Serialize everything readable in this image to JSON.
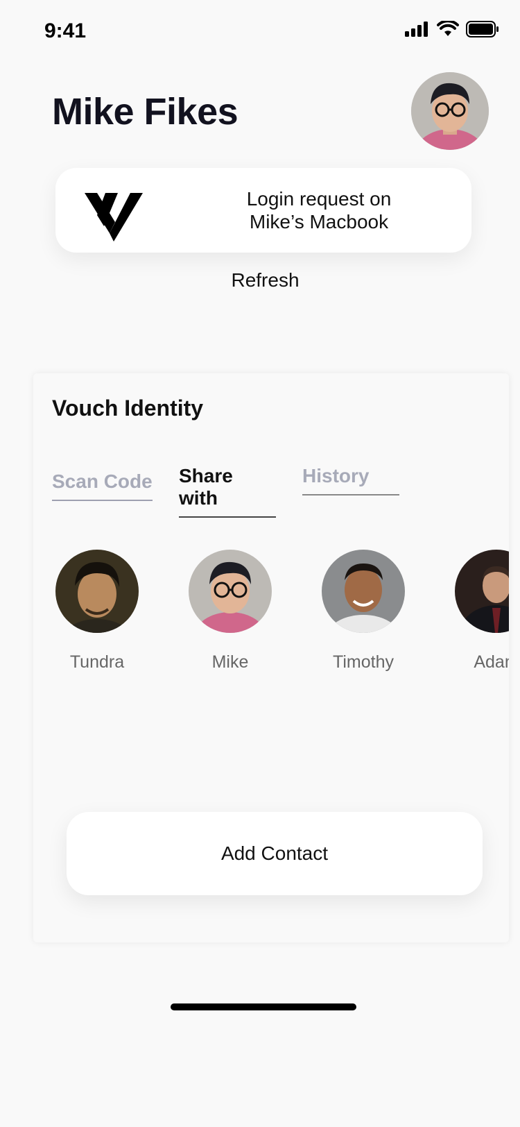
{
  "status_bar": {
    "time": "9:41",
    "icons": [
      "signal-icon",
      "wifi-icon",
      "battery-icon"
    ]
  },
  "header": {
    "title": "Mike Fikes"
  },
  "login_request": {
    "line1": "Login request on",
    "line2": "Mike’s Macbook"
  },
  "refresh_label": "Refresh",
  "identity": {
    "title": "Vouch Identity",
    "tabs": [
      {
        "label": "Scan Code",
        "active": false
      },
      {
        "label": "Share with",
        "active": true
      },
      {
        "label": "History",
        "active": false
      }
    ],
    "contacts": [
      {
        "name": "Tundra"
      },
      {
        "name": "Mike"
      },
      {
        "name": "Timothy"
      },
      {
        "name": "Adam"
      }
    ],
    "add_contact_label": "Add Contact"
  },
  "colors": {
    "background": "#f9f9f9",
    "card": "#ffffff",
    "inactive_tab": "#a7aab8",
    "title": "#12121f"
  }
}
